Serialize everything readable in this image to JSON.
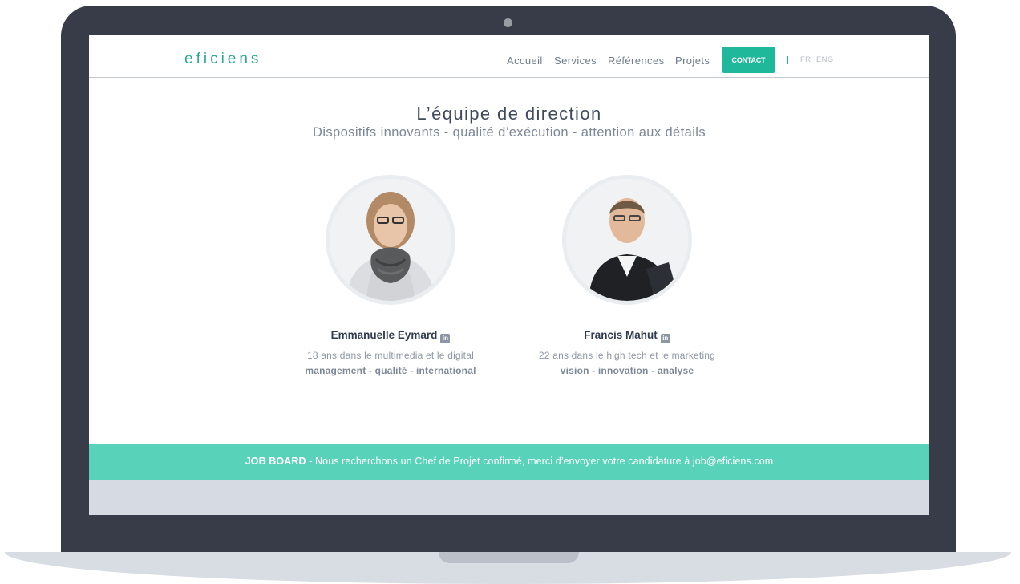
{
  "header": {
    "logo": "eficiens",
    "nav": [
      "Accueil",
      "Services",
      "Références",
      "Projets"
    ],
    "contact_label": "CONTACT",
    "languages": [
      "FR",
      "ENG"
    ]
  },
  "main": {
    "title": "L’équipe de direction",
    "subtitle": "Dispositifs innovants - qualité d’exécution - attention aux détails",
    "team": [
      {
        "name": "Emmanuelle Eymard",
        "description": "18 ans dans le multimedia et le digital",
        "skills": "management - qualité - international"
      },
      {
        "name": "Francis Mahut",
        "description": "22 ans dans le high tech et le marketing",
        "skills": "vision - innovation - analyse"
      }
    ]
  },
  "job_board": {
    "label": "JOB BOARD",
    "text": " - Nous recherchons un Chef de Projet confirmé, merci d’envoyer votre candidature à job@eficiens.com"
  },
  "colors": {
    "accent": "#1fb89a",
    "job_board_bg": "#58d2b9",
    "laptop_frame": "#383c48"
  },
  "icons": [
    "linkedin-icon",
    "camera-icon"
  ]
}
